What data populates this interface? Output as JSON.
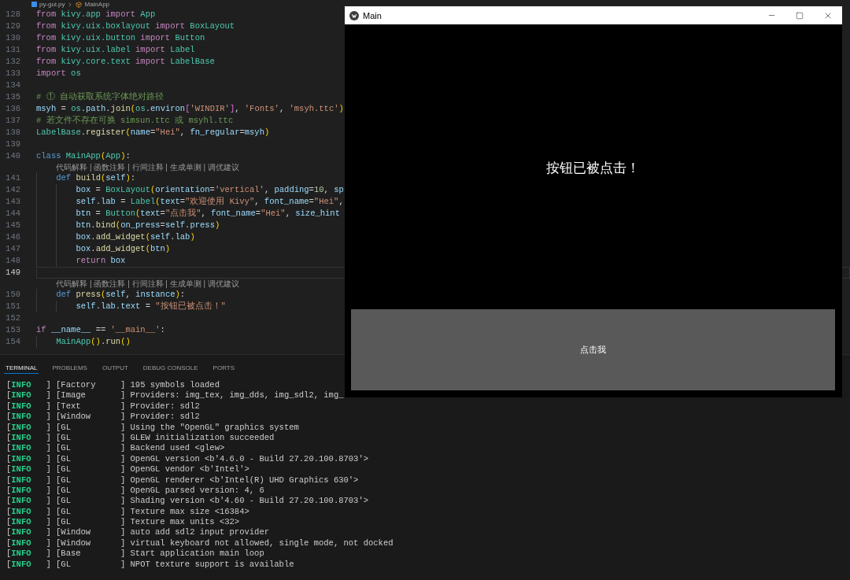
{
  "editor": {
    "breadcrumb": [
      {
        "text": "py-gui.py",
        "kind": "file"
      },
      {
        "text": "MainApp",
        "kind": "class"
      }
    ],
    "lines": [
      {
        "kind": "code",
        "number": "128",
        "current": false,
        "tokens": [
          {
            "text": "from ",
            "kind": "keyword"
          },
          {
            "text": "kivy.app ",
            "kind": "type"
          },
          {
            "text": "import ",
            "kind": "keyword"
          },
          {
            "text": "App",
            "kind": "type"
          }
        ]
      },
      {
        "kind": "code",
        "number": "129",
        "current": false,
        "tokens": [
          {
            "text": "from ",
            "kind": "keyword"
          },
          {
            "text": "kivy.uix.boxlayout ",
            "kind": "type"
          },
          {
            "text": "import ",
            "kind": "keyword"
          },
          {
            "text": "BoxLayout",
            "kind": "type"
          }
        ]
      },
      {
        "kind": "code",
        "number": "130",
        "current": false,
        "tokens": [
          {
            "text": "from ",
            "kind": "keyword"
          },
          {
            "text": "kivy.uix.button ",
            "kind": "type"
          },
          {
            "text": "import ",
            "kind": "keyword"
          },
          {
            "text": "Button",
            "kind": "type"
          }
        ]
      },
      {
        "kind": "code",
        "number": "131",
        "current": false,
        "tokens": [
          {
            "text": "from ",
            "kind": "keyword"
          },
          {
            "text": "kivy.uix.label ",
            "kind": "type"
          },
          {
            "text": "import ",
            "kind": "keyword"
          },
          {
            "text": "Label",
            "kind": "type"
          }
        ]
      },
      {
        "kind": "code",
        "number": "132",
        "current": false,
        "tokens": [
          {
            "text": "from ",
            "kind": "keyword"
          },
          {
            "text": "kivy.core.text ",
            "kind": "type"
          },
          {
            "text": "import ",
            "kind": "keyword"
          },
          {
            "text": "LabelBase",
            "kind": "type"
          }
        ]
      },
      {
        "kind": "code",
        "number": "133",
        "current": false,
        "tokens": [
          {
            "text": "import ",
            "kind": "keyword"
          },
          {
            "text": "os",
            "kind": "type"
          }
        ]
      },
      {
        "kind": "code",
        "number": "134",
        "current": false
      },
      {
        "kind": "code",
        "number": "135",
        "current": false,
        "tokens": [
          {
            "text": "# ① 自动获取系统字体绝对路径",
            "kind": "comment"
          }
        ]
      },
      {
        "kind": "code",
        "number": "136",
        "current": false,
        "tokens": [
          {
            "text": "msyh",
            "kind": "variable"
          },
          {
            "text": " = ",
            "kind": "plain"
          },
          {
            "text": "os",
            "kind": "type"
          },
          {
            "text": ".",
            "kind": "plain"
          },
          {
            "text": "path",
            "kind": "variable"
          },
          {
            "text": ".",
            "kind": "plain"
          },
          {
            "text": "join",
            "kind": "function"
          },
          {
            "text": "(",
            "kind": "bracket"
          },
          {
            "text": "os",
            "kind": "type"
          },
          {
            "text": ".",
            "kind": "plain"
          },
          {
            "text": "environ",
            "kind": "variable"
          },
          {
            "text": "[",
            "kind": "bracket2"
          },
          {
            "text": "'WINDIR'",
            "kind": "string"
          },
          {
            "text": "]",
            "kind": "bracket2"
          },
          {
            "text": ", ",
            "kind": "plain"
          },
          {
            "text": "'Fonts'",
            "kind": "string"
          },
          {
            "text": ", ",
            "kind": "plain"
          },
          {
            "text": "'msyh.ttc'",
            "kind": "string"
          },
          {
            "text": ")",
            "kind": "bracket"
          }
        ]
      },
      {
        "kind": "code",
        "number": "137",
        "current": false,
        "tokens": [
          {
            "text": "# 若文件不存在可换 simsun.ttc 或 msyhl.ttc",
            "kind": "comment"
          }
        ]
      },
      {
        "kind": "code",
        "number": "138",
        "current": false,
        "tokens": [
          {
            "text": "LabelBase",
            "kind": "type"
          },
          {
            "text": ".",
            "kind": "plain"
          },
          {
            "text": "register",
            "kind": "function"
          },
          {
            "text": "(",
            "kind": "bracket"
          },
          {
            "text": "name",
            "kind": "variable"
          },
          {
            "text": "=",
            "kind": "plain"
          },
          {
            "text": "\"Hei\"",
            "kind": "string"
          },
          {
            "text": ", ",
            "kind": "plain"
          },
          {
            "text": "fn_regular",
            "kind": "variable"
          },
          {
            "text": "=",
            "kind": "plain"
          },
          {
            "text": "msyh",
            "kind": "variable"
          },
          {
            "text": ")",
            "kind": "bracket"
          }
        ]
      },
      {
        "kind": "code",
        "number": "139",
        "current": false
      },
      {
        "kind": "code",
        "number": "140",
        "current": false,
        "tokens": [
          {
            "text": "class ",
            "kind": "storage"
          },
          {
            "text": "MainApp",
            "kind": "type"
          },
          {
            "text": "(",
            "kind": "bracket"
          },
          {
            "text": "App",
            "kind": "type"
          },
          {
            "text": ")",
            "kind": "bracket"
          },
          {
            "text": ":",
            "kind": "plain"
          }
        ]
      },
      {
        "kind": "codelens",
        "text": "代码解释 | 函数注释 | 行间注释 | 生成单测 | 调优建议"
      },
      {
        "kind": "code",
        "number": "141",
        "current": false,
        "tokens": [
          {
            "text": "    def ",
            "kind": "storage"
          },
          {
            "text": "build",
            "kind": "function"
          },
          {
            "text": "(",
            "kind": "bracket"
          },
          {
            "text": "self",
            "kind": "variable"
          },
          {
            "text": ")",
            "kind": "bracket"
          },
          {
            "text": ":",
            "kind": "plain"
          }
        ]
      },
      {
        "kind": "code",
        "number": "142",
        "current": false,
        "tokens": [
          {
            "text": "        box",
            "kind": "variable"
          },
          {
            "text": " = ",
            "kind": "plain"
          },
          {
            "text": "BoxLayout",
            "kind": "type"
          },
          {
            "text": "(",
            "kind": "bracket"
          },
          {
            "text": "orientation",
            "kind": "variable"
          },
          {
            "text": "=",
            "kind": "plain"
          },
          {
            "text": "'vertical'",
            "kind": "string"
          },
          {
            "text": ", ",
            "kind": "plain"
          },
          {
            "text": "padding",
            "kind": "variable"
          },
          {
            "text": "=",
            "kind": "plain"
          },
          {
            "text": "10",
            "kind": "number"
          },
          {
            "text": ", ",
            "kind": "plain"
          },
          {
            "text": "sp",
            "kind": "variable"
          }
        ]
      },
      {
        "kind": "code",
        "number": "143",
        "current": false,
        "tokens": [
          {
            "text": "        self",
            "kind": "variable"
          },
          {
            "text": ".",
            "kind": "plain"
          },
          {
            "text": "lab",
            "kind": "variable"
          },
          {
            "text": " = ",
            "kind": "plain"
          },
          {
            "text": "Label",
            "kind": "type"
          },
          {
            "text": "(",
            "kind": "bracket"
          },
          {
            "text": "text",
            "kind": "variable"
          },
          {
            "text": "=",
            "kind": "plain"
          },
          {
            "text": "\"欢迎使用 Kivy\"",
            "kind": "string"
          },
          {
            "text": ", ",
            "kind": "plain"
          },
          {
            "text": "font_name",
            "kind": "variable"
          },
          {
            "text": "=",
            "kind": "plain"
          },
          {
            "text": "\"Hei\"",
            "kind": "string"
          },
          {
            "text": ",",
            "kind": "plain"
          }
        ]
      },
      {
        "kind": "code",
        "number": "144",
        "current": false,
        "tokens": [
          {
            "text": "        btn",
            "kind": "variable"
          },
          {
            "text": " = ",
            "kind": "plain"
          },
          {
            "text": "Button",
            "kind": "type"
          },
          {
            "text": "(",
            "kind": "bracket"
          },
          {
            "text": "text",
            "kind": "variable"
          },
          {
            "text": "=",
            "kind": "plain"
          },
          {
            "text": "\"点击我\"",
            "kind": "string"
          },
          {
            "text": ", ",
            "kind": "plain"
          },
          {
            "text": "font_name",
            "kind": "variable"
          },
          {
            "text": "=",
            "kind": "plain"
          },
          {
            "text": "\"Hei\"",
            "kind": "string"
          },
          {
            "text": ", ",
            "kind": "plain"
          },
          {
            "text": "size_hint",
            "kind": "variable"
          }
        ]
      },
      {
        "kind": "code",
        "number": "145",
        "current": false,
        "tokens": [
          {
            "text": "        btn",
            "kind": "variable"
          },
          {
            "text": ".",
            "kind": "plain"
          },
          {
            "text": "bind",
            "kind": "function"
          },
          {
            "text": "(",
            "kind": "bracket"
          },
          {
            "text": "on_press",
            "kind": "variable"
          },
          {
            "text": "=",
            "kind": "plain"
          },
          {
            "text": "self",
            "kind": "variable"
          },
          {
            "text": ".",
            "kind": "plain"
          },
          {
            "text": "press",
            "kind": "variable"
          },
          {
            "text": ")",
            "kind": "bracket"
          }
        ]
      },
      {
        "kind": "code",
        "number": "146",
        "current": false,
        "tokens": [
          {
            "text": "        box",
            "kind": "variable"
          },
          {
            "text": ".",
            "kind": "plain"
          },
          {
            "text": "add_widget",
            "kind": "function"
          },
          {
            "text": "(",
            "kind": "bracket"
          },
          {
            "text": "self",
            "kind": "variable"
          },
          {
            "text": ".",
            "kind": "plain"
          },
          {
            "text": "lab",
            "kind": "variable"
          },
          {
            "text": ")",
            "kind": "bracket"
          }
        ]
      },
      {
        "kind": "code",
        "number": "147",
        "current": false,
        "tokens": [
          {
            "text": "        box",
            "kind": "variable"
          },
          {
            "text": ".",
            "kind": "plain"
          },
          {
            "text": "add_widget",
            "kind": "function"
          },
          {
            "text": "(",
            "kind": "bracket"
          },
          {
            "text": "btn",
            "kind": "variable"
          },
          {
            "text": ")",
            "kind": "bracket"
          }
        ]
      },
      {
        "kind": "code",
        "number": "148",
        "current": false,
        "tokens": [
          {
            "text": "        return ",
            "kind": "keyword"
          },
          {
            "text": "box",
            "kind": "variable"
          }
        ]
      },
      {
        "kind": "code",
        "number": "149",
        "current": true
      },
      {
        "kind": "codelens",
        "text": "代码解释 | 函数注释 | 行间注释 | 生成单测 | 调优建议"
      },
      {
        "kind": "code",
        "number": "150",
        "current": false,
        "tokens": [
          {
            "text": "    def ",
            "kind": "storage"
          },
          {
            "text": "press",
            "kind": "function"
          },
          {
            "text": "(",
            "kind": "bracket"
          },
          {
            "text": "self",
            "kind": "variable"
          },
          {
            "text": ", ",
            "kind": "plain"
          },
          {
            "text": "instance",
            "kind": "variable"
          },
          {
            "text": ")",
            "kind": "bracket"
          },
          {
            "text": ":",
            "kind": "plain"
          }
        ]
      },
      {
        "kind": "code",
        "number": "151",
        "current": false,
        "tokens": [
          {
            "text": "        self",
            "kind": "variable"
          },
          {
            "text": ".",
            "kind": "plain"
          },
          {
            "text": "lab",
            "kind": "variable"
          },
          {
            "text": ".",
            "kind": "plain"
          },
          {
            "text": "text",
            "kind": "variable"
          },
          {
            "text": " = ",
            "kind": "plain"
          },
          {
            "text": "\"按钮已被点击！\"",
            "kind": "string"
          }
        ]
      },
      {
        "kind": "code",
        "number": "152",
        "current": false
      },
      {
        "kind": "code",
        "number": "153",
        "current": false,
        "tokens": [
          {
            "text": "if ",
            "kind": "keyword"
          },
          {
            "text": "__name__",
            "kind": "variable"
          },
          {
            "text": " == ",
            "kind": "plain"
          },
          {
            "text": "'__main__'",
            "kind": "string"
          },
          {
            "text": ":",
            "kind": "plain"
          }
        ]
      },
      {
        "kind": "code",
        "number": "154",
        "current": false,
        "tokens": [
          {
            "text": "    MainApp",
            "kind": "type"
          },
          {
            "text": "()",
            "kind": "bracket"
          },
          {
            "text": ".",
            "kind": "plain"
          },
          {
            "text": "run",
            "kind": "function"
          },
          {
            "text": "()",
            "kind": "bracket"
          }
        ]
      }
    ]
  },
  "app_window": {
    "title": "Main",
    "label": "按钮已被点击！",
    "button": "点击我"
  },
  "terminal_panel": {
    "tabs": [
      {
        "label": "TERMINAL",
        "selected": true
      },
      {
        "label": "PROBLEMS",
        "selected": false
      },
      {
        "label": "OUTPUT",
        "selected": false
      },
      {
        "label": "DEBUG CONSOLE",
        "selected": false
      },
      {
        "label": "PORTS",
        "selected": false
      }
    ],
    "lines": [
      {
        "open": "[",
        "level": "INFO",
        "text": "   ] [Factory     ] 195 symbols loaded"
      },
      {
        "open": "[",
        "level": "INFO",
        "text": "   ] [Image       ] Providers: img_tex, img_dds, img_sdl2, img_"
      },
      {
        "open": "[",
        "level": "INFO",
        "text": "   ] [Text        ] Provider: sdl2"
      },
      {
        "open": "[",
        "level": "INFO",
        "text": "   ] [Window      ] Provider: sdl2"
      },
      {
        "open": "[",
        "level": "INFO",
        "text": "   ] [GL          ] Using the \"OpenGL\" graphics system"
      },
      {
        "open": "[",
        "level": "INFO",
        "text": "   ] [GL          ] GLEW initialization succeeded"
      },
      {
        "open": "[",
        "level": "INFO",
        "text": "   ] [GL          ] Backend used <glew>"
      },
      {
        "open": "[",
        "level": "INFO",
        "text": "   ] [GL          ] OpenGL version <b'4.6.0 - Build 27.20.100.8703'>"
      },
      {
        "open": "[",
        "level": "INFO",
        "text": "   ] [GL          ] OpenGL vendor <b'Intel'>"
      },
      {
        "open": "[",
        "level": "INFO",
        "text": "   ] [GL          ] OpenGL renderer <b'Intel(R) UHD Graphics 630'>"
      },
      {
        "open": "[",
        "level": "INFO",
        "text": "   ] [GL          ] OpenGL parsed version: 4, 6"
      },
      {
        "open": "[",
        "level": "INFO",
        "text": "   ] [GL          ] Shading version <b'4.60 - Build 27.20.100.8703'>"
      },
      {
        "open": "[",
        "level": "INFO",
        "text": "   ] [GL          ] Texture max size <16384>"
      },
      {
        "open": "[",
        "level": "INFO",
        "text": "   ] [GL          ] Texture max units <32>"
      },
      {
        "open": "[",
        "level": "INFO",
        "text": "   ] [Window      ] auto add sdl2 input provider"
      },
      {
        "open": "[",
        "level": "INFO",
        "text": "   ] [Window      ] virtual keyboard not allowed, single mode, not docked"
      },
      {
        "open": "[",
        "level": "INFO",
        "text": "   ] [Base        ] Start application main loop"
      },
      {
        "open": "[",
        "level": "INFO",
        "text": "   ] [GL          ] NPOT texture support is available"
      }
    ]
  }
}
